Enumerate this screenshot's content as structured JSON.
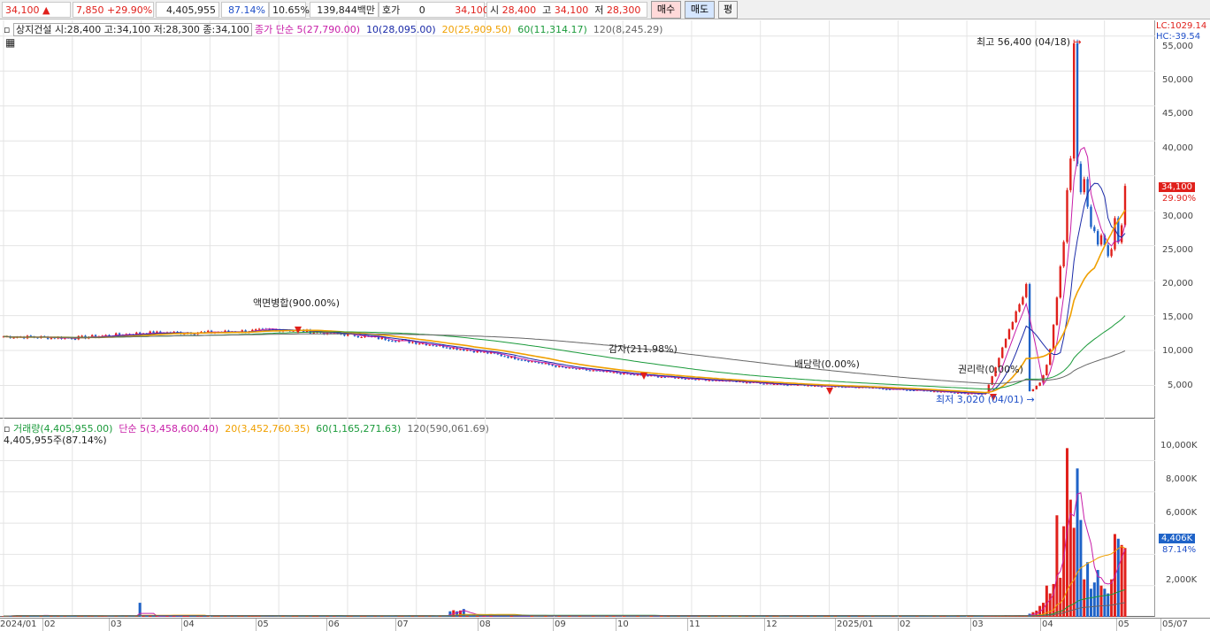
{
  "toolbar": {
    "price": "34,100",
    "change": "7,850",
    "change_pct": "+29.90%",
    "volume": "4,405,955",
    "vol_ratio": "87.14%",
    "turnover": "10.65%",
    "amount": "139,844백만",
    "quote_label": "호가",
    "quote_value": "0",
    "quote_price": "34,100",
    "open_label": "시",
    "open": "28,400",
    "high_label": "고",
    "high": "34,100",
    "low_label": "저",
    "low": "28,300",
    "buy_label": "매수",
    "sell_label": "매도",
    "flat_label": "평"
  },
  "price_pane": {
    "info": "상지건설 시:28,400 고:34,100 저:28,300 종:34,100",
    "ma_title": "종가 단순",
    "ma5": "5(27,790.00)",
    "ma10": "10(28,095.00)",
    "ma20": "20(25,909.50)",
    "ma60": "60(11,314.17)",
    "ma120": "120(8,245.29)",
    "lc": "LC:1029.14",
    "hc": "HC:-39.54",
    "current_price": "34,100",
    "current_pct": "29.90%",
    "max_note": "최고 56,400 (04/18)",
    "min_note": "최저 3,020 (04/01)",
    "events": [
      "액면병합(900.00%)",
      "감자(211.98%)",
      "배당락(0.00%)",
      "권리락(0.00%)"
    ],
    "axis_labels": [
      "55,000",
      "50,000",
      "45,000",
      "40,000",
      "35,000",
      "30,000",
      "25,000",
      "20,000",
      "15,000",
      "10,000",
      "5,000"
    ]
  },
  "volume_pane": {
    "title": "거래량",
    "vol": "(4,405,955.00)",
    "ma_title": "단순",
    "ma5": "5(3,458,600.40)",
    "ma20": "20(3,452,760.35)",
    "ma60": "60(1,165,271.63)",
    "ma120": "120(590,061.69)",
    "sub": "4,405,955주(87.14%)",
    "current": "4,406K",
    "current_pct": "87.14%",
    "axis_labels": [
      "10,000K",
      "8,000K",
      "6,000K",
      "4,000K",
      "2,000K"
    ]
  },
  "date_axis": [
    "2024/01",
    "02",
    "03",
    "04",
    "05",
    "06",
    "07",
    "08",
    "09",
    "10",
    "11",
    "12",
    "2025/01",
    "02",
    "03",
    "04",
    "05",
    "05/07"
  ],
  "colors": {
    "up": "#e0201b",
    "down": "#1f63c8",
    "ma5": "#c81ea8",
    "ma10": "#1a2aa8",
    "ma20": "#f0a000",
    "ma60": "#1a9a3a",
    "ma120": "#666666"
  },
  "chart_data": {
    "type": "candlestick",
    "x": [
      "2024/01",
      "02",
      "03",
      "04",
      "05",
      "06",
      "07",
      "08",
      "09",
      "10",
      "11",
      "12",
      "2025/01",
      "02",
      "03",
      "04",
      "05"
    ],
    "close": [
      12000,
      11800,
      12500,
      12600,
      13000,
      12200,
      11000,
      9500,
      7500,
      6500,
      5800,
      5200,
      4800,
      4300,
      3700,
      30000,
      34100
    ],
    "ylim": [
      0,
      57000
    ],
    "volume_ylim": [
      0,
      11500000
    ],
    "peak_volume": [
      10800000,
      9500000,
      7500000,
      5300000,
      4405955
    ]
  }
}
